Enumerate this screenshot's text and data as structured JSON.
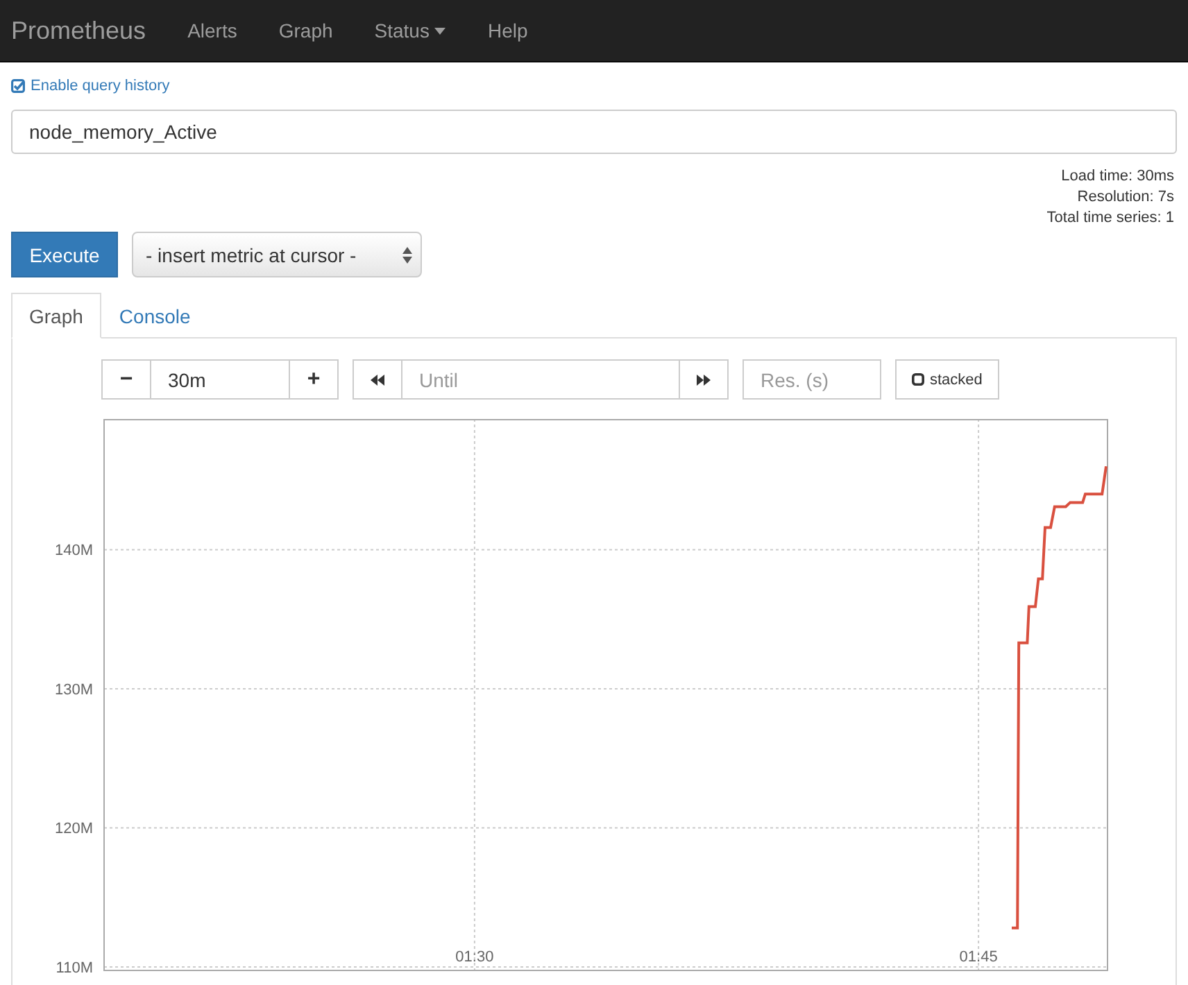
{
  "navbar": {
    "brand": "Prometheus",
    "items": [
      {
        "label": "Alerts",
        "dropdown": false
      },
      {
        "label": "Graph",
        "dropdown": false
      },
      {
        "label": "Status",
        "dropdown": true
      },
      {
        "label": "Help",
        "dropdown": false
      }
    ]
  },
  "query_history": {
    "label": "Enable query history",
    "checked": true
  },
  "expression": {
    "value": "node_memory_Active"
  },
  "stats": [
    "Load time: 30ms",
    "Resolution: 7s",
    "Total time series: 1"
  ],
  "execute_button": "Execute",
  "metric_select": {
    "value": "- insert metric at cursor -"
  },
  "tabs": [
    {
      "label": "Graph",
      "selected": true
    },
    {
      "label": "Console",
      "selected": false
    }
  ],
  "graph_controls": {
    "range_minus": "−",
    "range": "30m",
    "range_plus": "+",
    "until": {
      "placeholder": "Until"
    },
    "resolution": {
      "placeholder": "Res. (s)"
    },
    "stacked": {
      "label": "stacked",
      "checked": false
    }
  },
  "chart_data": {
    "type": "line",
    "x": [
      1.7665,
      1.7693,
      1.77,
      1.7742,
      1.775,
      1.7782,
      1.7797,
      1.7817,
      1.783,
      1.7858,
      1.7878,
      1.7933,
      1.7955,
      1.8017,
      1.803,
      1.8113,
      1.8133
    ],
    "series": [
      {
        "color": "#d9503f",
        "values": [
          112.8,
          112.8,
          133.3,
          133.3,
          135.9,
          135.9,
          137.9,
          137.9,
          141.6,
          141.6,
          143.1,
          143.1,
          143.4,
          143.4,
          144.0,
          144.0,
          146.0
        ]
      }
    ],
    "grid": true,
    "xlim": [
      1.3162,
      1.814
    ],
    "ylim": [
      109.8,
      149.4
    ],
    "xticks": [
      {
        "value": 1.5,
        "label": "01:30"
      },
      {
        "value": 1.75,
        "label": "01:45"
      }
    ],
    "yticks": [
      {
        "value": 110,
        "label": "110M"
      },
      {
        "value": 120,
        "label": "120M"
      },
      {
        "value": 130,
        "label": "130M"
      },
      {
        "value": 140,
        "label": "140M"
      }
    ]
  }
}
